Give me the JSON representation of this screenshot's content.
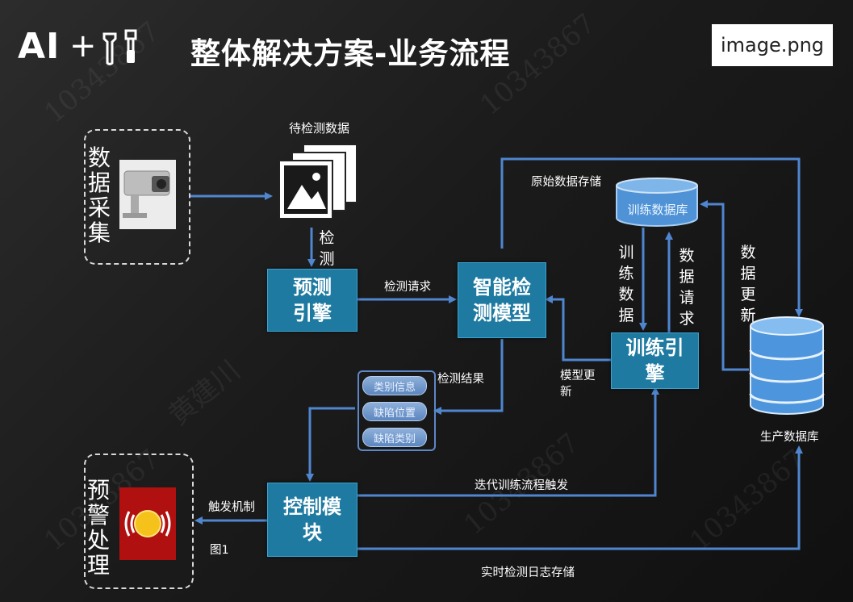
{
  "header": {
    "logo_text": "AI",
    "logo_plus": "+",
    "title": "整体解决方案-业务流程",
    "image_badge": "image.png"
  },
  "watermark": {
    "id": "10343867",
    "name": "黄建川"
  },
  "acquisition": {
    "label": "数据采集"
  },
  "pending_data": {
    "label": "待检测数据"
  },
  "nodes": {
    "predict_engine": "预测引擎",
    "smart_model": "智能检测模型",
    "train_engine": "训练引擎",
    "control_module": "控制模块"
  },
  "databases": {
    "train_db": "训练数据库",
    "prod_db": "生产数据库"
  },
  "edge_labels": {
    "detect": "检测",
    "detect_request": "检测请求",
    "raw_storage": "原始数据存储",
    "train_data": "训练数据",
    "data_request": "数据请求",
    "data_update": "数据更新",
    "model_update": "模型更新",
    "detect_result": "检测结果",
    "iterate_trigger": "迭代训练流程触发",
    "trigger_mechanism": "触发机制",
    "realtime_log": "实时检测日志存储",
    "figure": "图1"
  },
  "result_items": [
    "类别信息",
    "缺陷位置",
    "缺陷类别"
  ],
  "alarm": {
    "label": "预警处理"
  },
  "colors": {
    "node_fill": "#1e7aa1",
    "arrow": "#4f86cf",
    "db_fill": "#5aa0e0"
  }
}
